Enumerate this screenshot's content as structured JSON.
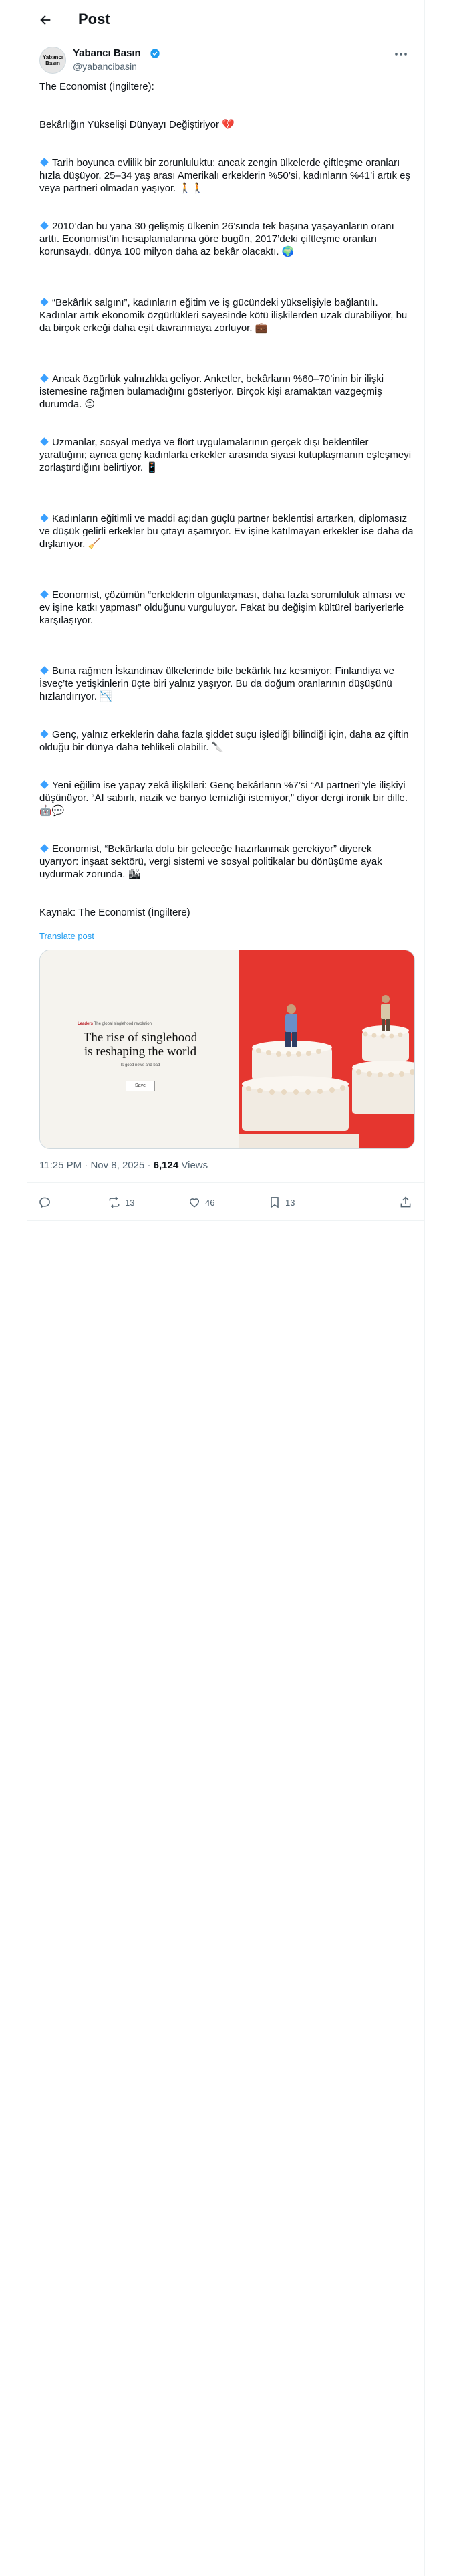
{
  "header": {
    "title": "Post"
  },
  "author": {
    "name": "Yabancı Basın",
    "handle": "@yabancibasin",
    "avatar_line1": "Yabancı",
    "avatar_line2": "Basın"
  },
  "post": {
    "source_line": "The Economist (İngiltere):",
    "headline": "Bekârlığın Yükselişi Dünyayı Değiştiriyor",
    "headline_emoji": "💔",
    "paragraphs": [
      "Tarih boyunca evlilik bir zorunluluktu; ancak zengin ülkelerde çiftleşme oranları hızla düşüyor. 25–34 yaş arası Amerikalı erkeklerin %50’si, kadınların %41’i artık eş veya partneri olmadan yaşıyor.",
      "2010’dan bu yana 30 gelişmiş ülkenin 26’sında tek başına yaşayanların oranı arttı. Economist’in hesaplamalarına göre bugün, 2017’deki çiftleşme oranları korunsaydı, dünya 100 milyon daha az bekâr olacaktı.",
      "“Bekârlık salgını”, kadınların eğitim ve iş gücündeki yükselişiyle bağlantılı. Kadınlar artık ekonomik özgürlükleri sayesinde kötü ilişkilerden uzak durabiliyor, bu da birçok erkeği daha eşit davranmaya zorluyor.",
      "Ancak özgürlük yalnızlıkla geliyor. Anketler, bekârların %60–70’inin bir ilişki istemesine rağmen bulamadığını gösteriyor. Birçok kişi aramaktan vazgeçmiş durumda.",
      "Uzmanlar, sosyal medya ve flört uygulamalarının gerçek dışı beklentiler yarattığını; ayrıca genç kadınlarla erkekler arasında siyasi kutuplaşmanın eşleşmeyi zorlaştırdığını belirtiyor.",
      "Kadınların eğitimli ve maddi açıdan güçlü partner beklentisi artarken, diplomasız ve düşük gelirli erkekler bu çıtayı aşamıyor. Ev işine katılmayan erkekler ise daha da dışlanıyor.",
      "Economist, çözümün “erkeklerin olgunlaşması, daha fazla sorumluluk alması ve ev işine katkı yapması” olduğunu vurguluyor. Fakat bu değişim kültürel bariyerlerle karşılaşıyor.",
      "Buna rağmen İskandinav ülkelerinde bile bekârlık hız kesmiyor: Finlandiya ve İsveç’te yetişkinlerin üçte biri yalnız yaşıyor. Bu da doğum oranlarının düşüşünü hızlandırıyor.",
      "Genç, yalnız erkeklerin daha fazla şiddet suçu işlediği bilindiği için, daha az çiftin olduğu bir dünya daha tehlikeli olabilir.",
      "Yeni eğilim ise yapay zekâ ilişkileri: Genç bekârların %7’si “AI partneri”yle ilişkiyi düşünüyor. “AI sabırlı, nazik ve banyo temizliği istemiyor,” diyor dergi ironik bir dille.",
      "Economist, “Bekârlarla dolu bir geleceğe hazırlanmak gerekiyor” diyerek uyarıyor: inşaat sektörü, vergi sistemi ve sosyal politikalar bu dönüşüme ayak uydurmak zorunda."
    ],
    "paragraph_emojis": [
      "🚶🚶",
      "🌍",
      "💼",
      "😔",
      "📱",
      "🧹",
      "",
      "📉",
      "🔪",
      "🤖💬",
      "🏙"
    ],
    "source_footer": "Kaynak: The Economist (İngiltere)",
    "translate_label": "Translate post"
  },
  "card": {
    "kicker_brand": "Leaders",
    "kicker_text": "The global singlehood revolution",
    "headline_line1": "The rise of singlehood",
    "headline_line2": "is reshaping the world",
    "subhead": "Is good news and bad",
    "button_label": "Save"
  },
  "meta": {
    "time": "11:25 PM",
    "date": "Nov 8, 2025",
    "separator": "·",
    "views_count": "6,124",
    "views_label": "Views"
  },
  "actions": {
    "replies": "",
    "reposts": "13",
    "likes": "46",
    "bookmarks": "13"
  },
  "colors": {
    "accent": "#1d9bf0",
    "text": "#0f1419",
    "muted": "#536471",
    "card_red": "#e5362f"
  }
}
